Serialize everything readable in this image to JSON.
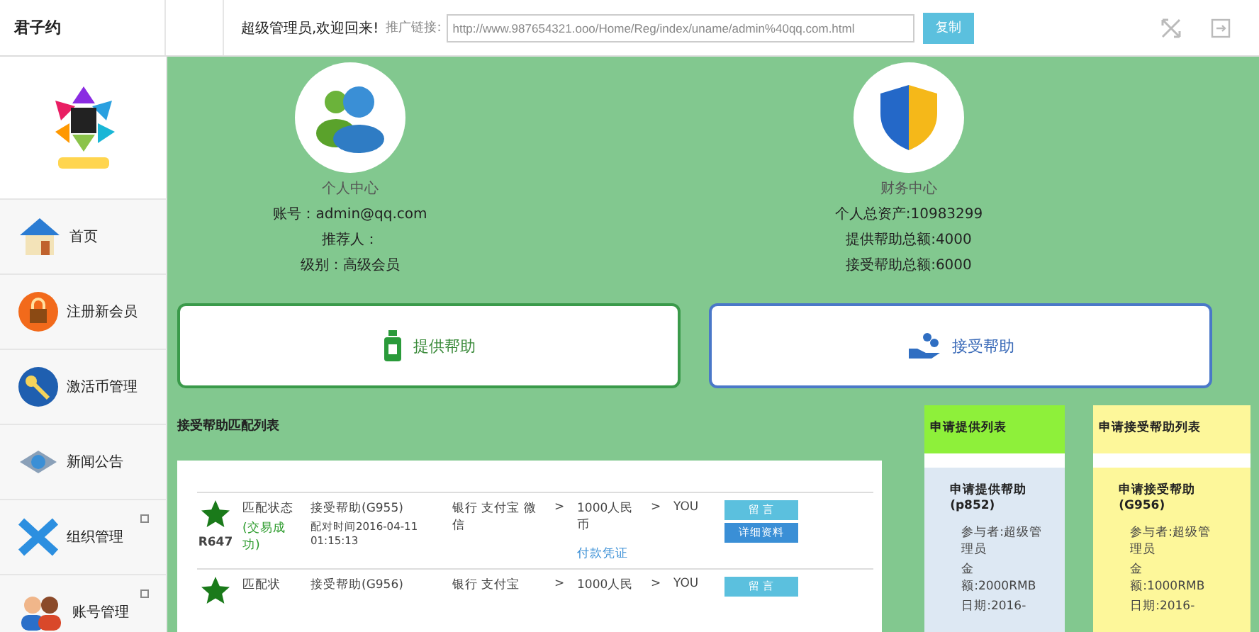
{
  "header": {
    "logo_text": "君子约",
    "welcome": "超级管理员,欢迎回来!",
    "promo_label": "推广链接:",
    "promo_url": "http://www.987654321.ooo/Home/Reg/index/uname/admin%40qq.com.html",
    "copy_button": "复制"
  },
  "sidebar": {
    "items": [
      {
        "label": "首页",
        "expandable": false
      },
      {
        "label": "注册新会员",
        "expandable": false
      },
      {
        "label": "激活币管理",
        "expandable": false
      },
      {
        "label": "新闻公告",
        "expandable": false
      },
      {
        "label": "组织管理",
        "expandable": true
      },
      {
        "label": "账号管理",
        "expandable": true
      }
    ]
  },
  "profiles": [
    {
      "kind": "personal",
      "title": "个人中心",
      "lines": [
        "账号：admin@qq.com",
        "推荐人：",
        "级别：高级会员"
      ]
    },
    {
      "kind": "finance",
      "title": "财务中心",
      "lines": [
        "个人总资产:10983299",
        "提供帮助总额:4000",
        "接受帮助总额:6000"
      ]
    }
  ],
  "actions": [
    {
      "kind": "provide",
      "label": "提供帮助"
    },
    {
      "kind": "receive",
      "label": "接受帮助"
    }
  ],
  "match_list": {
    "title": "接受帮助匹配列表",
    "rows": [
      {
        "id": "R647",
        "status": "匹配状态",
        "result": "(交易成功)",
        "title": "接受帮助(G955)",
        "time": "配对时间2016-04-11 01:15:13",
        "methods": "银行 支付宝 微信",
        "sep1": ">",
        "amount": "1000人民币",
        "proof_link": "付款凭证",
        "sep2": ">",
        "receiver": "YOU",
        "message_button": "留 言",
        "details_button": "详细资料"
      },
      {
        "id": "",
        "status": "匹配状",
        "result": "",
        "title": "接受帮助(G956)",
        "time": "",
        "methods": "银行 支付宝",
        "sep1": ">",
        "amount": "1000人民",
        "proof_link": "",
        "sep2": ">",
        "receiver": "YOU",
        "message_button": "留 言",
        "details_button": ""
      }
    ]
  },
  "side_lists": [
    {
      "kind": "provide",
      "title": "申请提供列表",
      "item_title": "申请提供帮助",
      "item_code": "(p852)",
      "lines": [
        "参与者:超级管理员",
        "金额:2000RMB",
        "日期:2016-"
      ]
    },
    {
      "kind": "receive",
      "title": "申请接受帮助列表",
      "item_title": "申请接受帮助",
      "item_code": "(G956)",
      "lines": [
        "参与者:超级管理员",
        "金额:1000RMB",
        "日期:2016-"
      ]
    }
  ]
}
